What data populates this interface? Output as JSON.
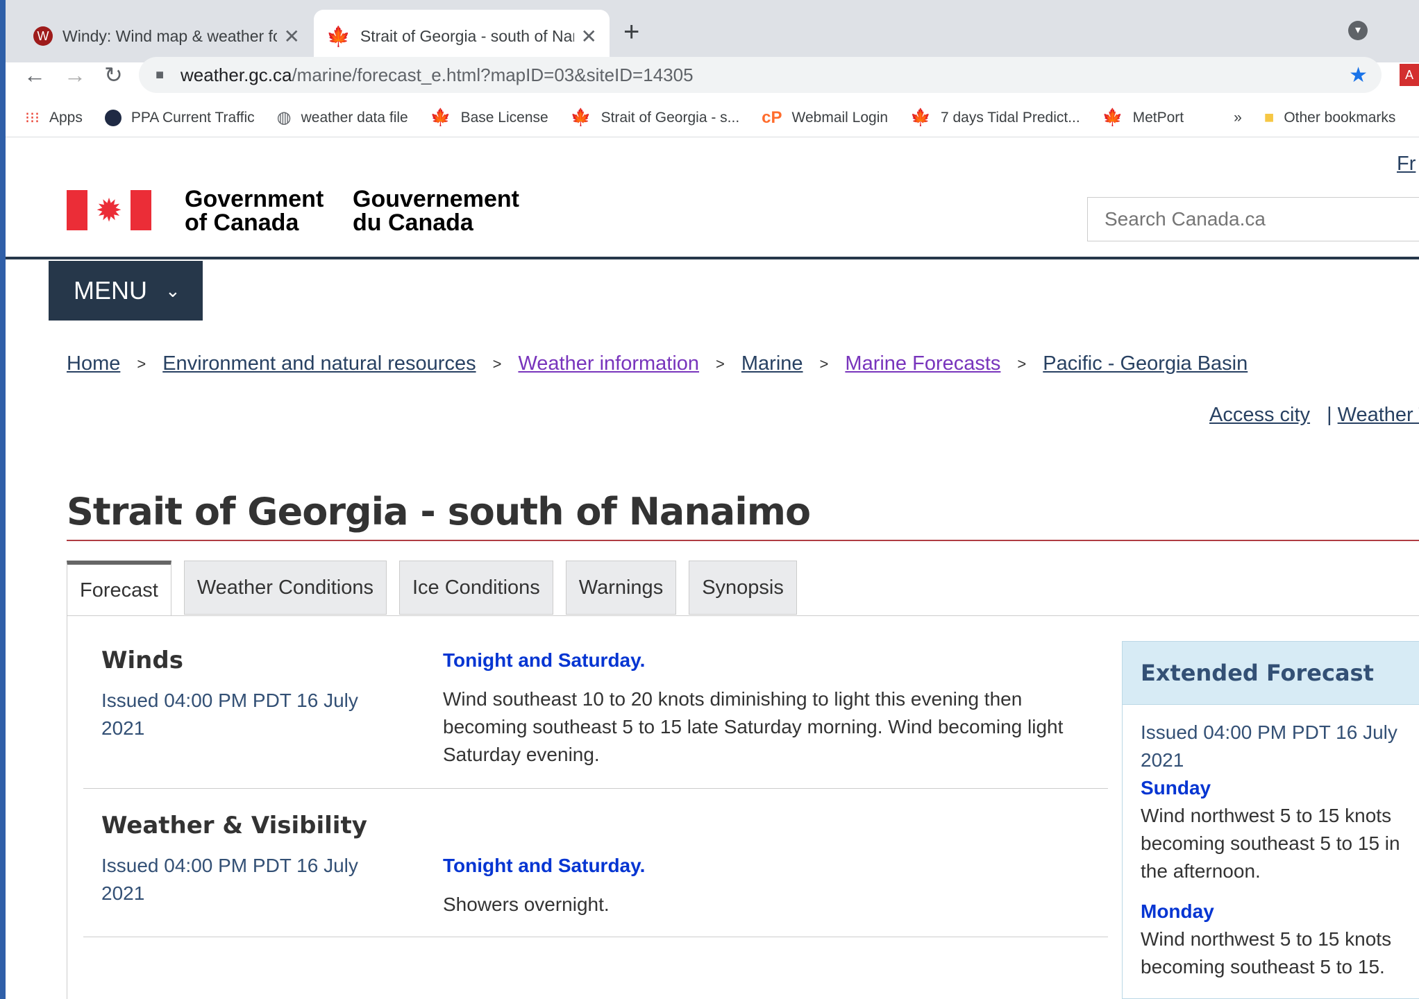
{
  "browser": {
    "tabs": [
      {
        "title": "Windy: Wind map & weather forecast",
        "icon": "windy-icon",
        "active": false
      },
      {
        "title": "Strait of Georgia - south of Nanaimo",
        "icon": "maple-leaf-icon",
        "active": true
      }
    ],
    "url_host": "weather.gc.ca",
    "url_path": "/marine/forecast_e.html?mapID=03&siteID=14305",
    "bookmarks": [
      {
        "label": "Apps",
        "icon": "apps-grid-icon"
      },
      {
        "label": "PPA Current Traffic",
        "icon": "ppa-icon"
      },
      {
        "label": "weather data file",
        "icon": "globe-icon"
      },
      {
        "label": "Base License",
        "icon": "maple-leaf-icon"
      },
      {
        "label": "Strait of Georgia - s...",
        "icon": "maple-leaf-icon"
      },
      {
        "label": "Webmail Login",
        "icon": "cpanel-icon"
      },
      {
        "label": "7 days Tidal Predict...",
        "icon": "maple-leaf-icon"
      },
      {
        "label": "MetPort",
        "icon": "maple-leaf-icon"
      }
    ],
    "overflow_label": "»",
    "other_bookmarks": "Other bookmarks"
  },
  "header": {
    "lang_link": "Fr",
    "gov_en_1": "Government",
    "gov_en_2": "of Canada",
    "gov_fr_1": "Gouvernement",
    "gov_fr_2": "du Canada",
    "search_placeholder": "Search Canada.ca",
    "menu_label": "MENU"
  },
  "breadcrumbs": [
    {
      "label": "Home",
      "visited": false
    },
    {
      "label": "Environment and natural resources",
      "visited": false
    },
    {
      "label": "Weather information",
      "visited": true
    },
    {
      "label": "Marine",
      "visited": false
    },
    {
      "label": "Marine Forecasts",
      "visited": true
    },
    {
      "label": "Pacific - Georgia Basin",
      "visited": false
    }
  ],
  "breadcrumb_sep": ">",
  "secondary_links": {
    "access_city": "Access city",
    "sep": "|",
    "weather": "Weather T"
  },
  "page_title": "Strait of Georgia - south of Nanaimo",
  "tabs": [
    "Forecast",
    "Weather Conditions",
    "Ice Conditions",
    "Warnings",
    "Synopsis"
  ],
  "sections": {
    "winds": {
      "title": "Winds",
      "issued": "Issued 04:00 PM PDT 16 July 2021",
      "period": "Tonight and Saturday.",
      "text": "Wind southeast 10 to 20 knots diminishing to light this evening then becoming southeast 5 to 15 late Saturday morning. Wind becoming light Saturday evening."
    },
    "weather": {
      "title": "Weather & Visibility",
      "issued": "Issued 04:00 PM PDT 16 July 2021",
      "period": "Tonight and Saturday.",
      "text": "Showers overnight."
    }
  },
  "extended": {
    "title": "Extended Forecast",
    "issued": "Issued 04:00 PM PDT 16 July 2021",
    "days": [
      {
        "day": "Sunday",
        "text": "Wind northwest 5 to 15 knots becoming southeast 5 to 15 in the afternoon."
      },
      {
        "day": "Monday",
        "text": "Wind northwest 5 to 15 knots becoming southeast 5 to 15."
      }
    ]
  }
}
